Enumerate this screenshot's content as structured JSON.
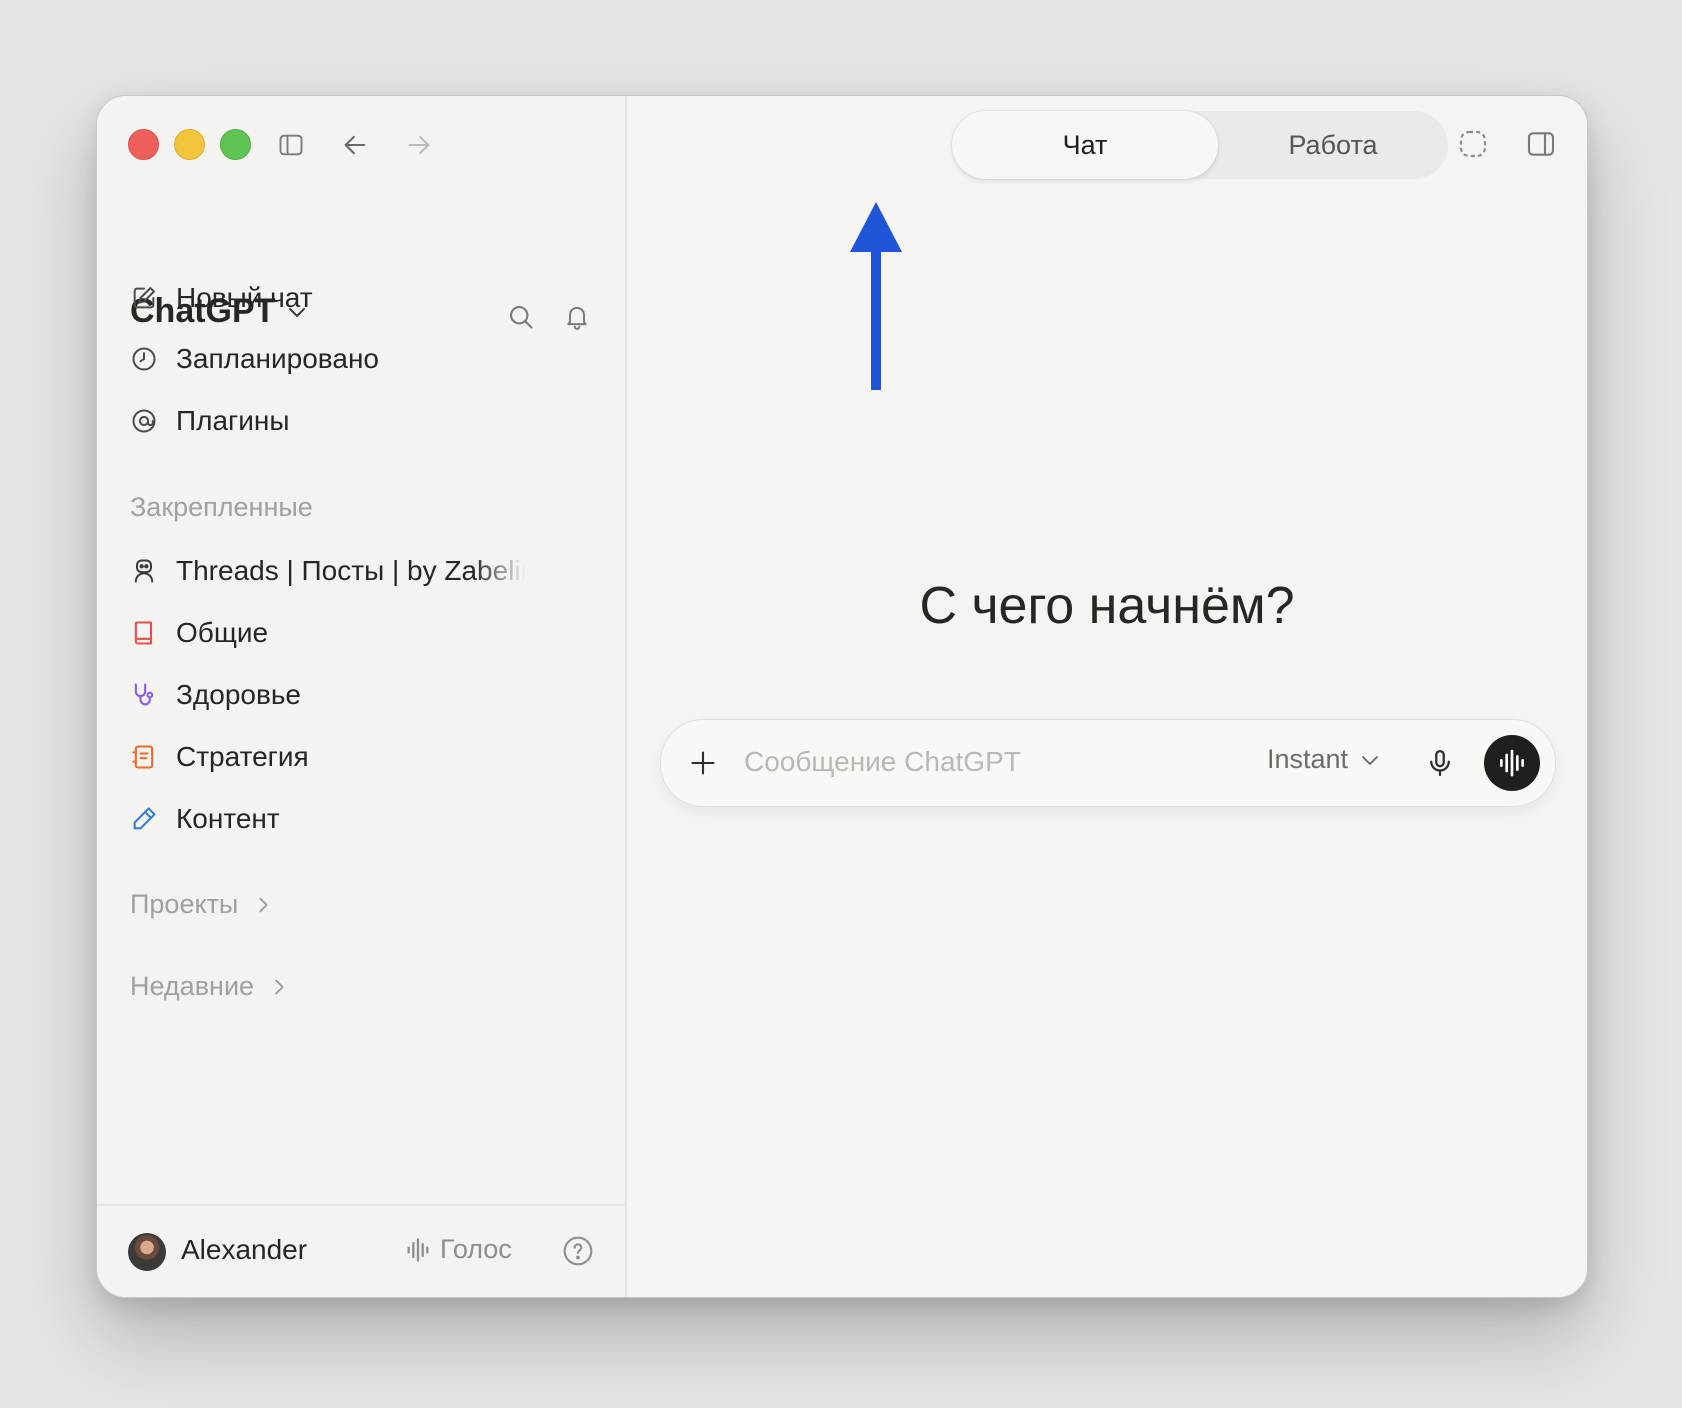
{
  "sidebar": {
    "brand": "ChatGPT",
    "nav": [
      {
        "label": "Новый чат",
        "icon": "compose-icon"
      },
      {
        "label": "Запланировано",
        "icon": "clock-icon"
      },
      {
        "label": "Плагины",
        "icon": "plugins-icon"
      }
    ],
    "pinned_title": "Закрепленные",
    "pinned": [
      {
        "label": "Threads | Посты | by Zabelin",
        "icon": "robot-icon",
        "color": "#3a3a3a"
      },
      {
        "label": "Общие",
        "icon": "book-icon",
        "color": "#e5534b"
      },
      {
        "label": "Здоровье",
        "icon": "stethoscope-icon",
        "color": "#8b5cf6"
      },
      {
        "label": "Стратегия",
        "icon": "document-icon",
        "color": "#ee6b2d"
      },
      {
        "label": "Контент",
        "icon": "pencil-icon",
        "color": "#3b7ddd"
      }
    ],
    "projects_label": "Проекты",
    "recent_label": "Недавние",
    "user": {
      "name": "Alexander"
    },
    "voice_label": "Голос"
  },
  "tabs": {
    "chat": "Чат",
    "work": "Работа",
    "active": "Чат"
  },
  "main": {
    "heading": "С чего начнём?",
    "composer": {
      "placeholder": "Сообщение ChatGPT",
      "value": "",
      "model": "Instant"
    }
  },
  "colors": {
    "annotation_arrow": "#1f55d6",
    "voice_button": "#1f1f1f",
    "window_bg": "#f5f4f0"
  }
}
